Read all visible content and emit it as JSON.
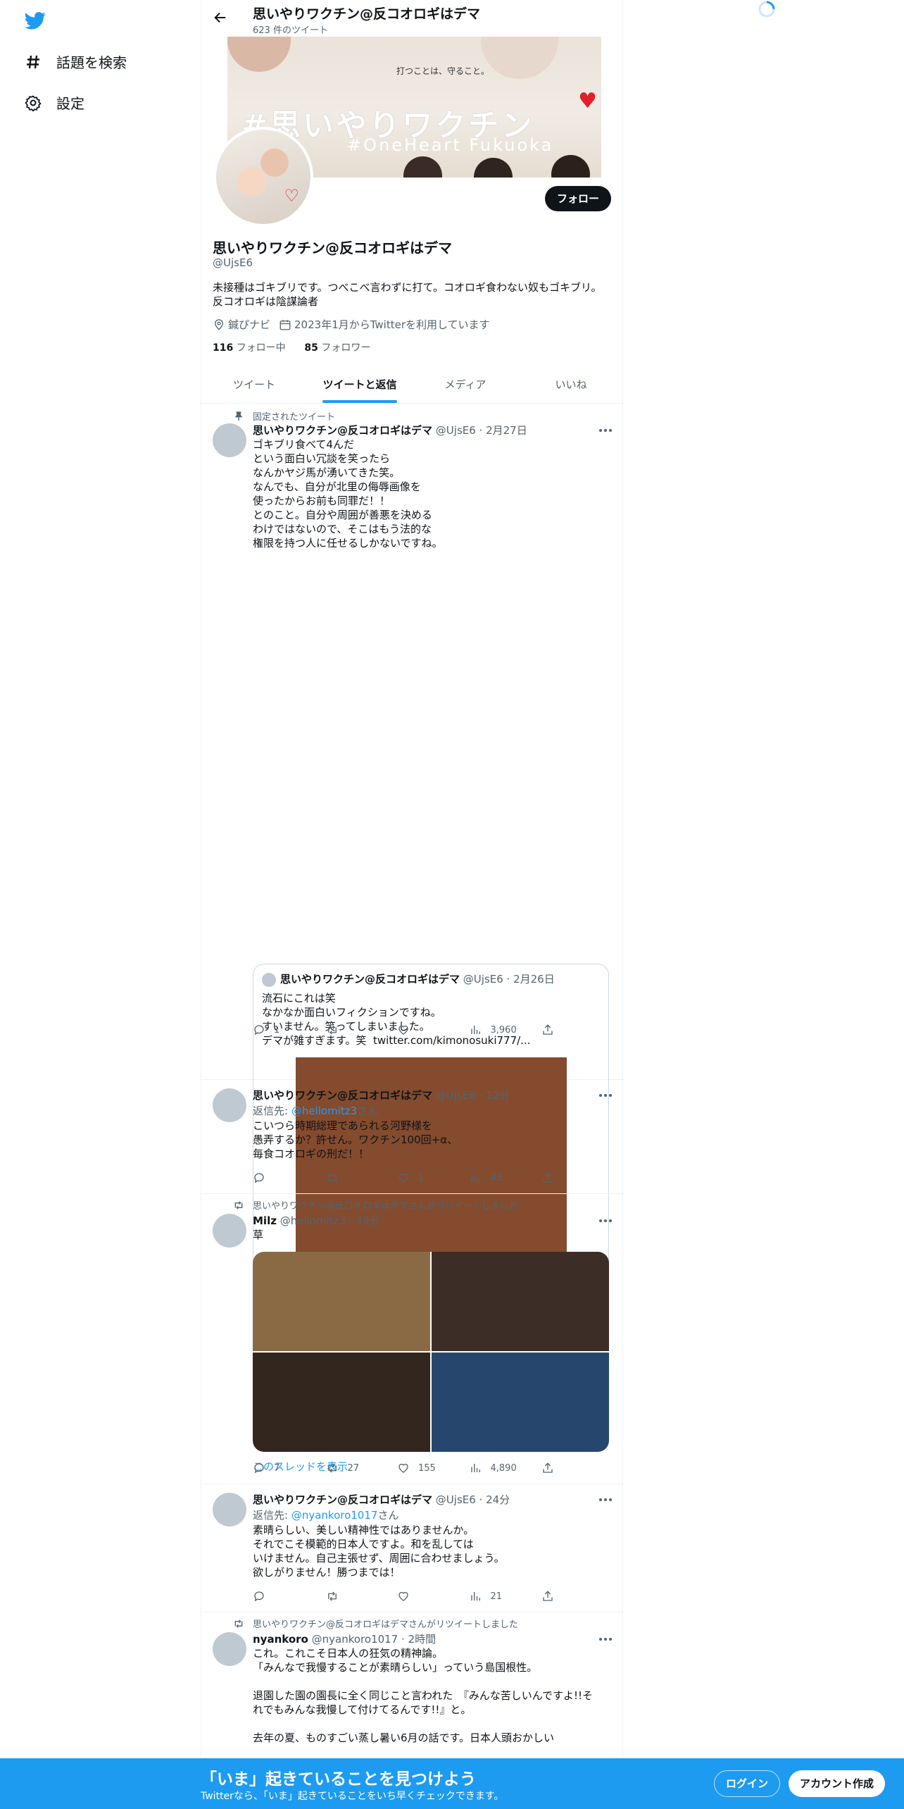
{
  "nav": {
    "explore_label": "話題を検索",
    "settings_label": "設定"
  },
  "header": {
    "name": "思いやりワクチン@反コオロギはデマ",
    "tweet_count": "623 件のツイート"
  },
  "banner": {
    "tagline": "打つことは、守ること。",
    "hashtag": "#思いやりワクチン",
    "sub": "#OneHeart Fukuoka"
  },
  "profile": {
    "follow_label": "フォロー",
    "name": "思いやりワクチン@反コオロギはデマ",
    "handle": "@UjsE6",
    "bio": "未接種はゴキブリです。つべこべ言わずに打て。コオロギ食わない奴もゴキブリ。\n反コオロギは陰謀論者",
    "location": "鍼ぴナビ",
    "joined": "2023年1月からTwitterを利用しています",
    "following_count": "116",
    "following_label": "フォロー中",
    "followers_count": "85",
    "followers_label": "フォロワー"
  },
  "tabs": [
    {
      "label": "ツイート"
    },
    {
      "label": "ツイートと返信"
    },
    {
      "label": "メディア"
    },
    {
      "label": "いいね"
    }
  ],
  "tweets": [
    {
      "context": "固定されたツイート",
      "name": "思いやりワクチン@反コオロギはデマ",
      "meta": "@UjsE6 · 2月27日",
      "text": "ゴキブリ食べて4んだ\nという面白い冗談を笑ったら\nなんかヤジ馬が湧いてきた笑。\nなんでも、自分が北里の侮辱画像を\n使ったからお前も同罪だ！！\nとのこと。自分や周囲が善悪を決める\nわけではないので、そこはもう法的な\n権限を持つ人に任せるしかないですね。",
      "quote": {
        "name": "思いやりワクチン@反コオロギはデマ",
        "meta": "@UjsE6 · 2月26日",
        "text": "流石にこれは笑\nなかなか面白いフィクションですね。\nすいません。笑ってしまいました。\nデマが雑すぎます。笑  twitter.com/kimonosuki777/...",
        "image_color": "#844b2e"
      },
      "replies": "1",
      "retweets": "",
      "likes": "",
      "views": "3,960",
      "thread_link": "このスレッドを表示"
    },
    {
      "name": "思いやりワクチン@反コオロギはデマ",
      "meta": "@UjsE6 · 12分",
      "reply_prefix": "返信先: ",
      "reply_to": "@hellomitz3",
      "reply_suffix": "さん",
      "text": "こいつら時期総理であられる河野様を\n愚弄するか？許せん。ワクチン100回+α、\n毎食コオロギの刑だ！！",
      "replies": "",
      "retweets": "",
      "likes": "1",
      "views": "43"
    },
    {
      "context": "思いやりワクチン@反コオロギはデマさんがリツイートしました",
      "name": "Milz",
      "meta": "@hellomitz3 · 49分",
      "text": "草",
      "image_colors": [
        "#8a6a45",
        "#3c2e26",
        "#33261f",
        "#26466e"
      ],
      "replies": "7",
      "retweets": "27",
      "likes": "155",
      "views": "4,890"
    },
    {
      "name": "思いやりワクチン@反コオロギはデマ",
      "meta": "@UjsE6 · 24分",
      "reply_prefix": "返信先: ",
      "reply_to": "@nyankoro1017",
      "reply_suffix": "さん",
      "text": "素晴らしい、美しい精神性ではありませんか。\nそれでこそ模範的日本人ですよ。和を乱しては\nいけません。自己主張せず、周囲に合わせましょう。\n欲しがりません！勝つまでは！",
      "replies": "",
      "retweets": "",
      "likes": "",
      "views": "21"
    },
    {
      "context": "思いやりワクチン@反コオロギはデマさんがリツイートしました",
      "name": "nyankoro",
      "meta": "@nyankoro1017 · 2時間",
      "text": "これ。これこそ日本人の狂気の精神論。\n「みんなで我慢することが素晴らしい」っていう島国根性。\n\n退園した園の園長に全く同じこと言われた　『みんな苦しいんですよ!!そ\nれでもみんな我慢して付けてるんです!!』と。\n\n去年の夏、ものすごい蒸し暑い6月の話です。日本人頭おかしい"
    }
  ],
  "bottom_bar": {
    "title": "「いま」起きていることを見つけよう",
    "subtitle": "Twitterなら、「いま」起きていることをいち早くチェックできます。",
    "login_label": "ログイン",
    "signup_label": "アカウント作成"
  },
  "colors": {
    "accent": "#1d9bf0",
    "text": "#0f1419",
    "secondary": "#536471"
  }
}
